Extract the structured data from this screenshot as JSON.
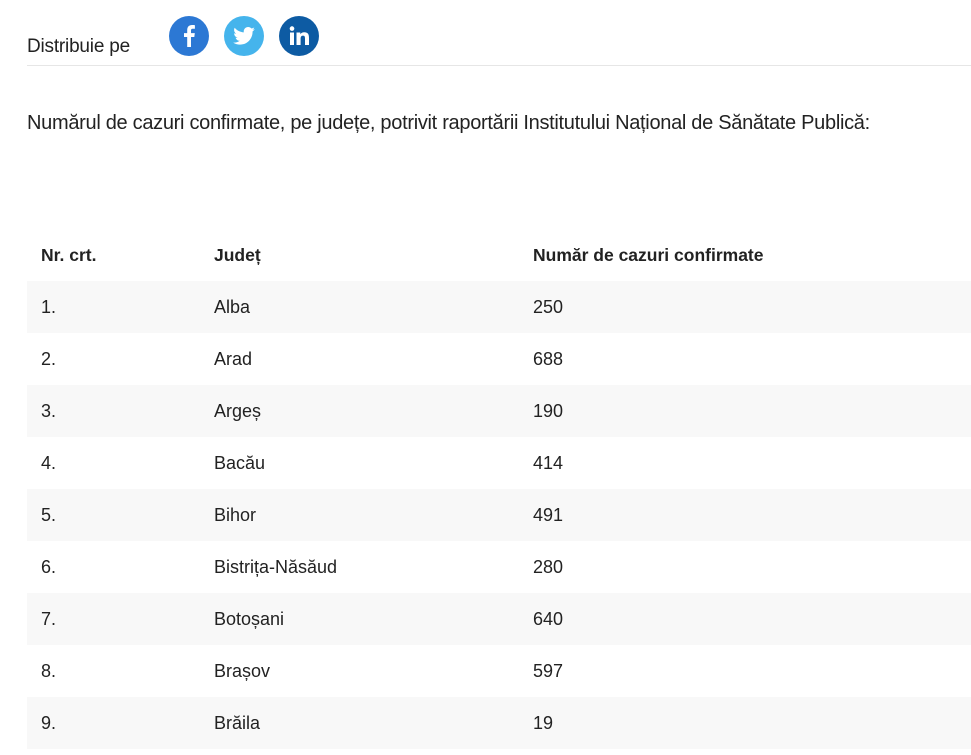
{
  "share": {
    "label": "Distribuie pe",
    "icons": [
      "facebook-icon",
      "twitter-icon",
      "linkedin-icon"
    ],
    "colors": {
      "facebook": "#2c78d4",
      "twitter": "#45b4ec",
      "linkedin": "#0d5ba3"
    }
  },
  "intro": "Numărul de cazuri confirmate, pe județe, potrivit raportării Institutului Național de Sănătate Publică:",
  "table": {
    "headers": [
      "Nr. crt.",
      "Județ",
      "Număr de cazuri confirmate"
    ],
    "rows": [
      [
        "1.",
        "Alba",
        "250"
      ],
      [
        "2.",
        "Arad",
        "688"
      ],
      [
        "3.",
        "Argeș",
        "190"
      ],
      [
        "4.",
        "Bacău",
        "414"
      ],
      [
        "5.",
        "Bihor",
        "491"
      ],
      [
        "6.",
        "Bistrița-Năsăud",
        "280"
      ],
      [
        "7.",
        "Botoșani",
        "640"
      ],
      [
        "8.",
        "Brașov",
        "597"
      ],
      [
        "9.",
        "Brăila",
        "19"
      ]
    ]
  }
}
